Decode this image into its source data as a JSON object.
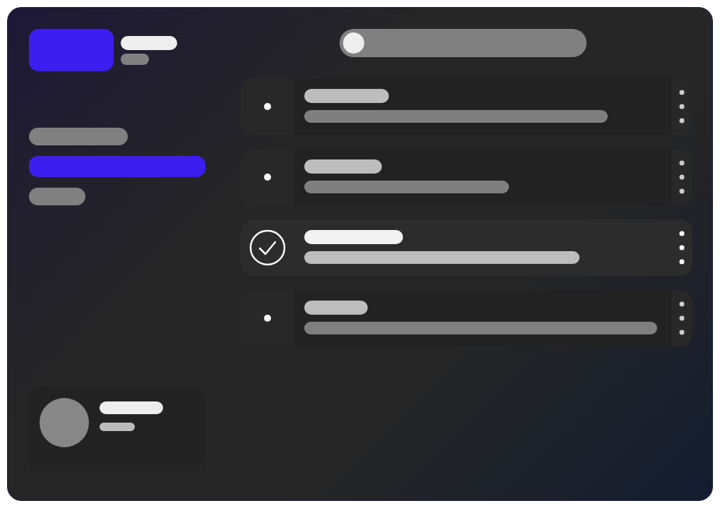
{
  "sidebar": {
    "nav_items": [
      {
        "selected": false
      },
      {
        "selected": true
      },
      {
        "selected": false
      }
    ]
  },
  "top_toggle": {
    "on": false
  },
  "tasks": [
    {
      "selected": false
    },
    {
      "selected": false
    },
    {
      "selected": true
    },
    {
      "selected": false
    }
  ]
}
